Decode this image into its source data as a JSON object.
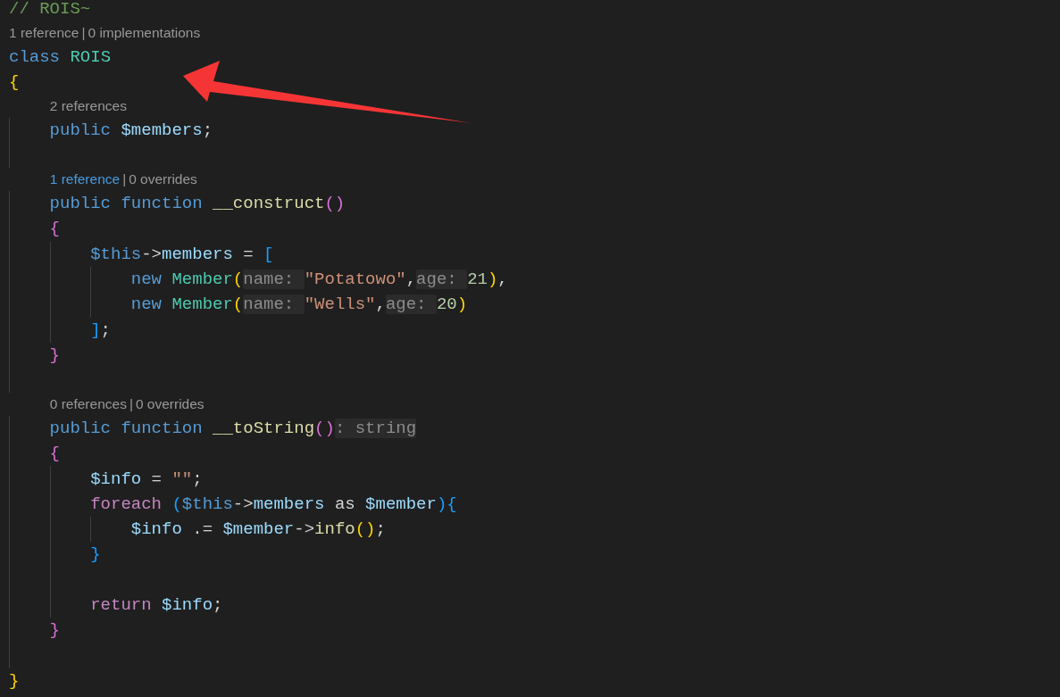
{
  "editor": {
    "lines": [
      {
        "kind": "code",
        "tokens": [
          {
            "kind": "comment",
            "text": "// ROIS~"
          }
        ]
      },
      {
        "kind": "lens",
        "separator": "|",
        "parts": [
          {
            "text": "1 reference",
            "hovered": false
          },
          {
            "text": "0 implementations",
            "hovered": false
          }
        ]
      },
      {
        "kind": "code",
        "tokens": [
          {
            "kind": "keyword",
            "text": "class "
          },
          {
            "kind": "type",
            "text": "ROIS"
          }
        ]
      },
      {
        "kind": "code",
        "tokens": [
          {
            "kind": "bracket1",
            "text": "{"
          }
        ]
      },
      {
        "kind": "lens",
        "parts": [
          {
            "text": "2 references",
            "hovered": false
          }
        ]
      },
      {
        "kind": "code",
        "tokens": [
          {
            "kind": "keyword",
            "text": "    public "
          },
          {
            "kind": "variable",
            "text": "$members"
          },
          {
            "kind": "plain",
            "text": ";"
          }
        ]
      },
      {
        "kind": "blank"
      },
      {
        "kind": "lens",
        "separator": "|",
        "parts": [
          {
            "text": "1 reference",
            "hovered": true
          },
          {
            "text": "0 overrides",
            "hovered": false
          }
        ]
      },
      {
        "kind": "code",
        "tokens": [
          {
            "kind": "keyword",
            "text": "    public function "
          },
          {
            "kind": "function",
            "text": "__construct"
          },
          {
            "kind": "bracket2",
            "text": "()"
          }
        ]
      },
      {
        "kind": "code",
        "tokens": [
          {
            "kind": "bracket2",
            "text": "    {"
          }
        ]
      },
      {
        "kind": "code",
        "tokens": [
          {
            "kind": "this",
            "text": "        $this"
          },
          {
            "kind": "plain",
            "text": "->"
          },
          {
            "kind": "variable",
            "text": "members"
          },
          {
            "kind": "plain",
            "text": " = "
          },
          {
            "kind": "bracket3",
            "text": "["
          }
        ]
      },
      {
        "kind": "code",
        "tokens": [
          {
            "kind": "keyword",
            "text": "            new "
          },
          {
            "kind": "type",
            "text": "Member"
          },
          {
            "kind": "bracket1",
            "text": "("
          },
          {
            "kind": "hint",
            "text": "name: "
          },
          {
            "kind": "string",
            "text": "\"Potatowo\""
          },
          {
            "kind": "plain",
            "text": ","
          },
          {
            "kind": "hint",
            "text": "age: "
          },
          {
            "kind": "number",
            "text": "21"
          },
          {
            "kind": "bracket1",
            "text": ")"
          },
          {
            "kind": "plain",
            "text": ","
          }
        ]
      },
      {
        "kind": "code",
        "tokens": [
          {
            "kind": "keyword",
            "text": "            new "
          },
          {
            "kind": "type",
            "text": "Member"
          },
          {
            "kind": "bracket1",
            "text": "("
          },
          {
            "kind": "hint",
            "text": "name: "
          },
          {
            "kind": "string",
            "text": "\"Wells\""
          },
          {
            "kind": "plain",
            "text": ","
          },
          {
            "kind": "hint",
            "text": "age: "
          },
          {
            "kind": "number",
            "text": "20"
          },
          {
            "kind": "bracket1",
            "text": ")"
          }
        ]
      },
      {
        "kind": "code",
        "tokens": [
          {
            "kind": "bracket3",
            "text": "        ]"
          },
          {
            "kind": "plain",
            "text": ";"
          }
        ]
      },
      {
        "kind": "code",
        "tokens": [
          {
            "kind": "bracket2",
            "text": "    }"
          }
        ]
      },
      {
        "kind": "blank"
      },
      {
        "kind": "lens",
        "separator": "|",
        "parts": [
          {
            "text": "0 references",
            "hovered": false
          },
          {
            "text": "0 overrides",
            "hovered": false
          }
        ]
      },
      {
        "kind": "code",
        "tokens": [
          {
            "kind": "keyword",
            "text": "    public function "
          },
          {
            "kind": "function",
            "text": "__toString"
          },
          {
            "kind": "bracket2",
            "text": "()"
          },
          {
            "kind": "hint",
            "text": ": string"
          }
        ]
      },
      {
        "kind": "code",
        "tokens": [
          {
            "kind": "bracket2",
            "text": "    {"
          }
        ]
      },
      {
        "kind": "code",
        "tokens": [
          {
            "kind": "variable",
            "text": "        $info"
          },
          {
            "kind": "plain",
            "text": " = "
          },
          {
            "kind": "string",
            "text": "\"\""
          },
          {
            "kind": "plain",
            "text": ";"
          }
        ]
      },
      {
        "kind": "code",
        "tokens": [
          {
            "kind": "control",
            "text": "        foreach "
          },
          {
            "kind": "bracket3",
            "text": "("
          },
          {
            "kind": "this",
            "text": "$this"
          },
          {
            "kind": "plain",
            "text": "->"
          },
          {
            "kind": "variable",
            "text": "members "
          },
          {
            "kind": "plain",
            "text": "as "
          },
          {
            "kind": "variable",
            "text": "$member"
          },
          {
            "kind": "bracket3",
            "text": "){"
          }
        ]
      },
      {
        "kind": "code",
        "tokens": [
          {
            "kind": "variable",
            "text": "            $info"
          },
          {
            "kind": "plain",
            "text": " .= "
          },
          {
            "kind": "variable",
            "text": "$member"
          },
          {
            "kind": "plain",
            "text": "->"
          },
          {
            "kind": "function",
            "text": "info"
          },
          {
            "kind": "bracket1",
            "text": "()"
          },
          {
            "kind": "plain",
            "text": ";"
          }
        ]
      },
      {
        "kind": "code",
        "tokens": [
          {
            "kind": "bracket3",
            "text": "        }"
          }
        ]
      },
      {
        "kind": "blank"
      },
      {
        "kind": "code",
        "tokens": [
          {
            "kind": "control",
            "text": "        return "
          },
          {
            "kind": "variable",
            "text": "$info"
          },
          {
            "kind": "plain",
            "text": ";"
          }
        ]
      },
      {
        "kind": "code",
        "tokens": [
          {
            "kind": "bracket2",
            "text": "    }"
          }
        ]
      },
      {
        "kind": "blank"
      },
      {
        "kind": "code",
        "tokens": [
          {
            "kind": "bracket1",
            "text": "}"
          }
        ]
      }
    ]
  }
}
